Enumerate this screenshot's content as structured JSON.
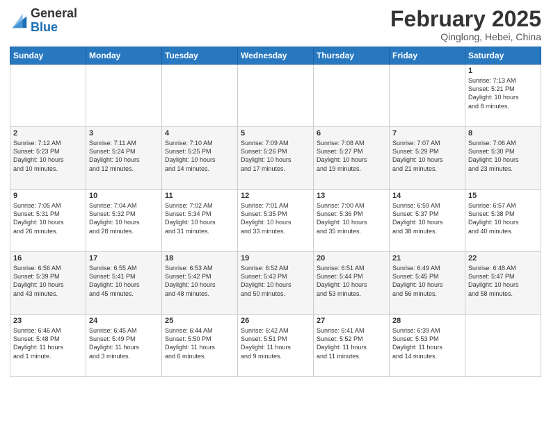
{
  "logo": {
    "general": "General",
    "blue": "Blue"
  },
  "header": {
    "month": "February 2025",
    "location": "Qinglong, Hebei, China"
  },
  "days_of_week": [
    "Sunday",
    "Monday",
    "Tuesday",
    "Wednesday",
    "Thursday",
    "Friday",
    "Saturday"
  ],
  "weeks": [
    [
      {
        "day": "",
        "detail": ""
      },
      {
        "day": "",
        "detail": ""
      },
      {
        "day": "",
        "detail": ""
      },
      {
        "day": "",
        "detail": ""
      },
      {
        "day": "",
        "detail": ""
      },
      {
        "day": "",
        "detail": ""
      },
      {
        "day": "1",
        "detail": "Sunrise: 7:13 AM\nSunset: 5:21 PM\nDaylight: 10 hours\nand 8 minutes."
      }
    ],
    [
      {
        "day": "2",
        "detail": "Sunrise: 7:12 AM\nSunset: 5:23 PM\nDaylight: 10 hours\nand 10 minutes."
      },
      {
        "day": "3",
        "detail": "Sunrise: 7:11 AM\nSunset: 5:24 PM\nDaylight: 10 hours\nand 12 minutes."
      },
      {
        "day": "4",
        "detail": "Sunrise: 7:10 AM\nSunset: 5:25 PM\nDaylight: 10 hours\nand 14 minutes."
      },
      {
        "day": "5",
        "detail": "Sunrise: 7:09 AM\nSunset: 5:26 PM\nDaylight: 10 hours\nand 17 minutes."
      },
      {
        "day": "6",
        "detail": "Sunrise: 7:08 AM\nSunset: 5:27 PM\nDaylight: 10 hours\nand 19 minutes."
      },
      {
        "day": "7",
        "detail": "Sunrise: 7:07 AM\nSunset: 5:29 PM\nDaylight: 10 hours\nand 21 minutes."
      },
      {
        "day": "8",
        "detail": "Sunrise: 7:06 AM\nSunset: 5:30 PM\nDaylight: 10 hours\nand 23 minutes."
      }
    ],
    [
      {
        "day": "9",
        "detail": "Sunrise: 7:05 AM\nSunset: 5:31 PM\nDaylight: 10 hours\nand 26 minutes."
      },
      {
        "day": "10",
        "detail": "Sunrise: 7:04 AM\nSunset: 5:32 PM\nDaylight: 10 hours\nand 28 minutes."
      },
      {
        "day": "11",
        "detail": "Sunrise: 7:02 AM\nSunset: 5:34 PM\nDaylight: 10 hours\nand 31 minutes."
      },
      {
        "day": "12",
        "detail": "Sunrise: 7:01 AM\nSunset: 5:35 PM\nDaylight: 10 hours\nand 33 minutes."
      },
      {
        "day": "13",
        "detail": "Sunrise: 7:00 AM\nSunset: 5:36 PM\nDaylight: 10 hours\nand 35 minutes."
      },
      {
        "day": "14",
        "detail": "Sunrise: 6:59 AM\nSunset: 5:37 PM\nDaylight: 10 hours\nand 38 minutes."
      },
      {
        "day": "15",
        "detail": "Sunrise: 6:57 AM\nSunset: 5:38 PM\nDaylight: 10 hours\nand 40 minutes."
      }
    ],
    [
      {
        "day": "16",
        "detail": "Sunrise: 6:56 AM\nSunset: 5:39 PM\nDaylight: 10 hours\nand 43 minutes."
      },
      {
        "day": "17",
        "detail": "Sunrise: 6:55 AM\nSunset: 5:41 PM\nDaylight: 10 hours\nand 45 minutes."
      },
      {
        "day": "18",
        "detail": "Sunrise: 6:53 AM\nSunset: 5:42 PM\nDaylight: 10 hours\nand 48 minutes."
      },
      {
        "day": "19",
        "detail": "Sunrise: 6:52 AM\nSunset: 5:43 PM\nDaylight: 10 hours\nand 50 minutes."
      },
      {
        "day": "20",
        "detail": "Sunrise: 6:51 AM\nSunset: 5:44 PM\nDaylight: 10 hours\nand 53 minutes."
      },
      {
        "day": "21",
        "detail": "Sunrise: 6:49 AM\nSunset: 5:45 PM\nDaylight: 10 hours\nand 56 minutes."
      },
      {
        "day": "22",
        "detail": "Sunrise: 6:48 AM\nSunset: 5:47 PM\nDaylight: 10 hours\nand 58 minutes."
      }
    ],
    [
      {
        "day": "23",
        "detail": "Sunrise: 6:46 AM\nSunset: 5:48 PM\nDaylight: 11 hours\nand 1 minute."
      },
      {
        "day": "24",
        "detail": "Sunrise: 6:45 AM\nSunset: 5:49 PM\nDaylight: 11 hours\nand 3 minutes."
      },
      {
        "day": "25",
        "detail": "Sunrise: 6:44 AM\nSunset: 5:50 PM\nDaylight: 11 hours\nand 6 minutes."
      },
      {
        "day": "26",
        "detail": "Sunrise: 6:42 AM\nSunset: 5:51 PM\nDaylight: 11 hours\nand 9 minutes."
      },
      {
        "day": "27",
        "detail": "Sunrise: 6:41 AM\nSunset: 5:52 PM\nDaylight: 11 hours\nand 11 minutes."
      },
      {
        "day": "28",
        "detail": "Sunrise: 6:39 AM\nSunset: 5:53 PM\nDaylight: 11 hours\nand 14 minutes."
      },
      {
        "day": "",
        "detail": ""
      }
    ]
  ]
}
